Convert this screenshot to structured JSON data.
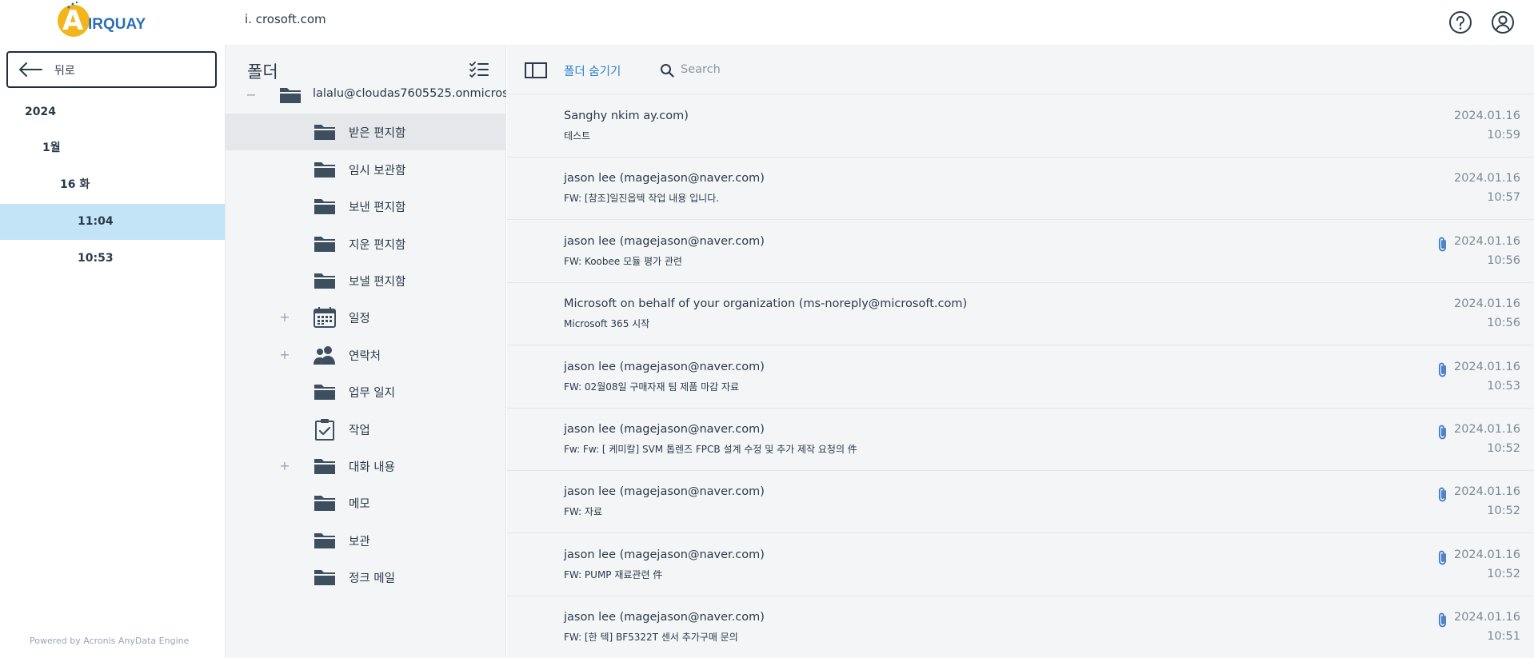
{
  "header": {
    "logo_text": "IRQUAY",
    "logo_letter": "A",
    "account": "i.               crosoft.com"
  },
  "leftnav": {
    "back_label": "뒤로",
    "tree": [
      {
        "label": "2024",
        "level": 0,
        "selected": false
      },
      {
        "label": "1월",
        "level": 1,
        "selected": false
      },
      {
        "label": "16 화",
        "level": 2,
        "selected": false
      },
      {
        "label": "11:04",
        "level": 3,
        "selected": true
      },
      {
        "label": "10:53",
        "level": 3,
        "selected": false
      }
    ],
    "powered": "Powered by Acronis AnyData Engine"
  },
  "folders": {
    "title": "폴더",
    "items": [
      {
        "label": "lalalu@cloudas7605525.onmicros",
        "toggle": "−",
        "icon": "folder-icon",
        "indent": 0,
        "selected": false
      },
      {
        "label": "받은 편지함",
        "toggle": "",
        "icon": "folder-icon",
        "indent": 1,
        "selected": true
      },
      {
        "label": "임시 보관함",
        "toggle": "",
        "icon": "folder-icon",
        "indent": 1,
        "selected": false
      },
      {
        "label": "보낸 편지함",
        "toggle": "",
        "icon": "folder-icon",
        "indent": 1,
        "selected": false
      },
      {
        "label": "지운 편지함",
        "toggle": "",
        "icon": "folder-icon",
        "indent": 1,
        "selected": false
      },
      {
        "label": "보낼 편지함",
        "toggle": "",
        "icon": "folder-icon",
        "indent": 1,
        "selected": false
      },
      {
        "label": "일정",
        "toggle": "+",
        "icon": "calendar-icon",
        "indent": 1,
        "selected": false
      },
      {
        "label": "연락처",
        "toggle": "+",
        "icon": "contacts-icon",
        "indent": 1,
        "selected": false
      },
      {
        "label": "업무 일지",
        "toggle": "",
        "icon": "folder-icon",
        "indent": 1,
        "selected": false
      },
      {
        "label": "작업",
        "toggle": "",
        "icon": "task-icon",
        "indent": 1,
        "selected": false
      },
      {
        "label": "대화 내용",
        "toggle": "+",
        "icon": "folder-icon",
        "indent": 1,
        "selected": false
      },
      {
        "label": "메모",
        "toggle": "",
        "icon": "folder-icon",
        "indent": 1,
        "selected": false
      },
      {
        "label": "보관",
        "toggle": "",
        "icon": "folder-icon",
        "indent": 1,
        "selected": false
      },
      {
        "label": "정크 메일",
        "toggle": "",
        "icon": "folder-icon",
        "indent": 1,
        "selected": false
      }
    ]
  },
  "toolbar": {
    "hide_folder_label": "폴더 숨기기",
    "search_placeholder": "Search"
  },
  "messages": [
    {
      "sender": "Sanghy            nkim              ay.com)",
      "subject": "테스트",
      "date": "2024.01.16",
      "time": "10:59",
      "attachment": false
    },
    {
      "sender": "jason lee (magejason@naver.com)",
      "subject": "FW: [참조]일진옵텍 작업 내용 입니다.",
      "date": "2024.01.16",
      "time": "10:57",
      "attachment": false
    },
    {
      "sender": "jason lee (magejason@naver.com)",
      "subject": "FW: Koobee 모듈 평가 관련",
      "date": "2024.01.16",
      "time": "10:56",
      "attachment": true
    },
    {
      "sender": "Microsoft on behalf of your organization (ms-noreply@microsoft.com)",
      "subject": "Microsoft 365 시작",
      "date": "2024.01.16",
      "time": "10:56",
      "attachment": false
    },
    {
      "sender": "jason lee (magejason@naver.com)",
      "subject": "FW: 02월08일 구매자재 팀 제품 마감 자료",
      "date": "2024.01.16",
      "time": "10:53",
      "attachment": true
    },
    {
      "sender": "jason lee (magejason@naver.com)",
      "subject": "Fw: Fw: [        케미칼] SVM 톱렌즈 FPCB 설계 수정 및 추가 제작 요청의 件",
      "date": "2024.01.16",
      "time": "10:52",
      "attachment": true
    },
    {
      "sender": "jason lee (magejason@naver.com)",
      "subject": "FW: 자료",
      "date": "2024.01.16",
      "time": "10:52",
      "attachment": true
    },
    {
      "sender": "jason lee (magejason@naver.com)",
      "subject": "FW: PUMP 재료관련 件",
      "date": "2024.01.16",
      "time": "10:52",
      "attachment": true
    },
    {
      "sender": "jason lee (magejason@naver.com)",
      "subject": "FW: [한        텍] BF5322T 센서 추가구매 문의",
      "date": "2024.01.16",
      "time": "10:51",
      "attachment": true
    }
  ],
  "colors": {
    "accent": "#2c7fc9",
    "selected_tree": "#c3e4f7",
    "icon_dark": "#3d4e5f",
    "logo_yellow": "#f2b51c",
    "logo_blue": "#2c6fb5"
  }
}
